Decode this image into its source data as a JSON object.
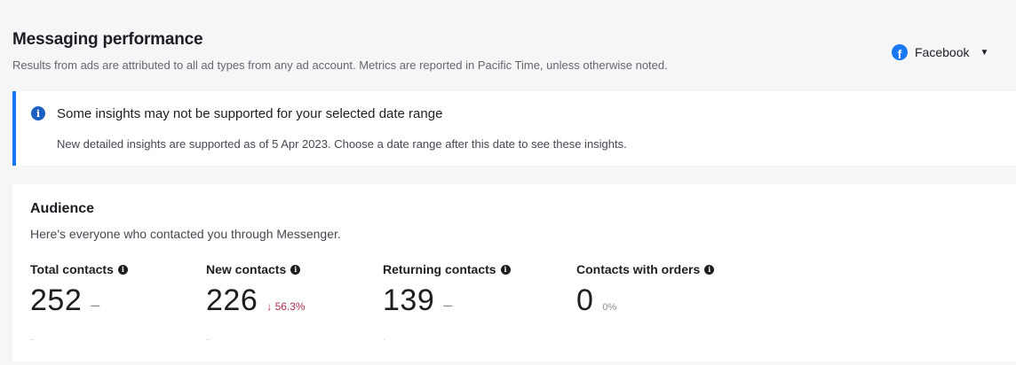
{
  "header": {
    "title": "Messaging performance",
    "subtitle": "Results from ads are attributed to all ad types from any ad account. Metrics are reported in Pacific Time, unless otherwise noted."
  },
  "platform_selector": {
    "icon": "facebook-icon",
    "label": "Facebook",
    "brand_color": "#1877f2"
  },
  "notice": {
    "icon": "info-icon",
    "title": "Some insights may not be supported for your selected date range",
    "body": "New detailed insights are supported as of 5 Apr 2023. Choose a date range after this date to see these insights.",
    "accent_color": "#1877f2"
  },
  "audience": {
    "title": "Audience",
    "subtitle": "Here's everyone who contacted you through Messenger.",
    "metrics": [
      {
        "label": "Total contacts",
        "value": "252",
        "change": "–",
        "foot": ".."
      },
      {
        "label": "New contacts",
        "value": "226",
        "change": "↓ 56.3%",
        "foot": ".."
      },
      {
        "label": "Returning contacts",
        "value": "139",
        "change": "–",
        "foot": "."
      },
      {
        "label": "Contacts with orders",
        "value": "0",
        "change": "0%"
      }
    ],
    "negative_change_color": "#b3314d"
  }
}
